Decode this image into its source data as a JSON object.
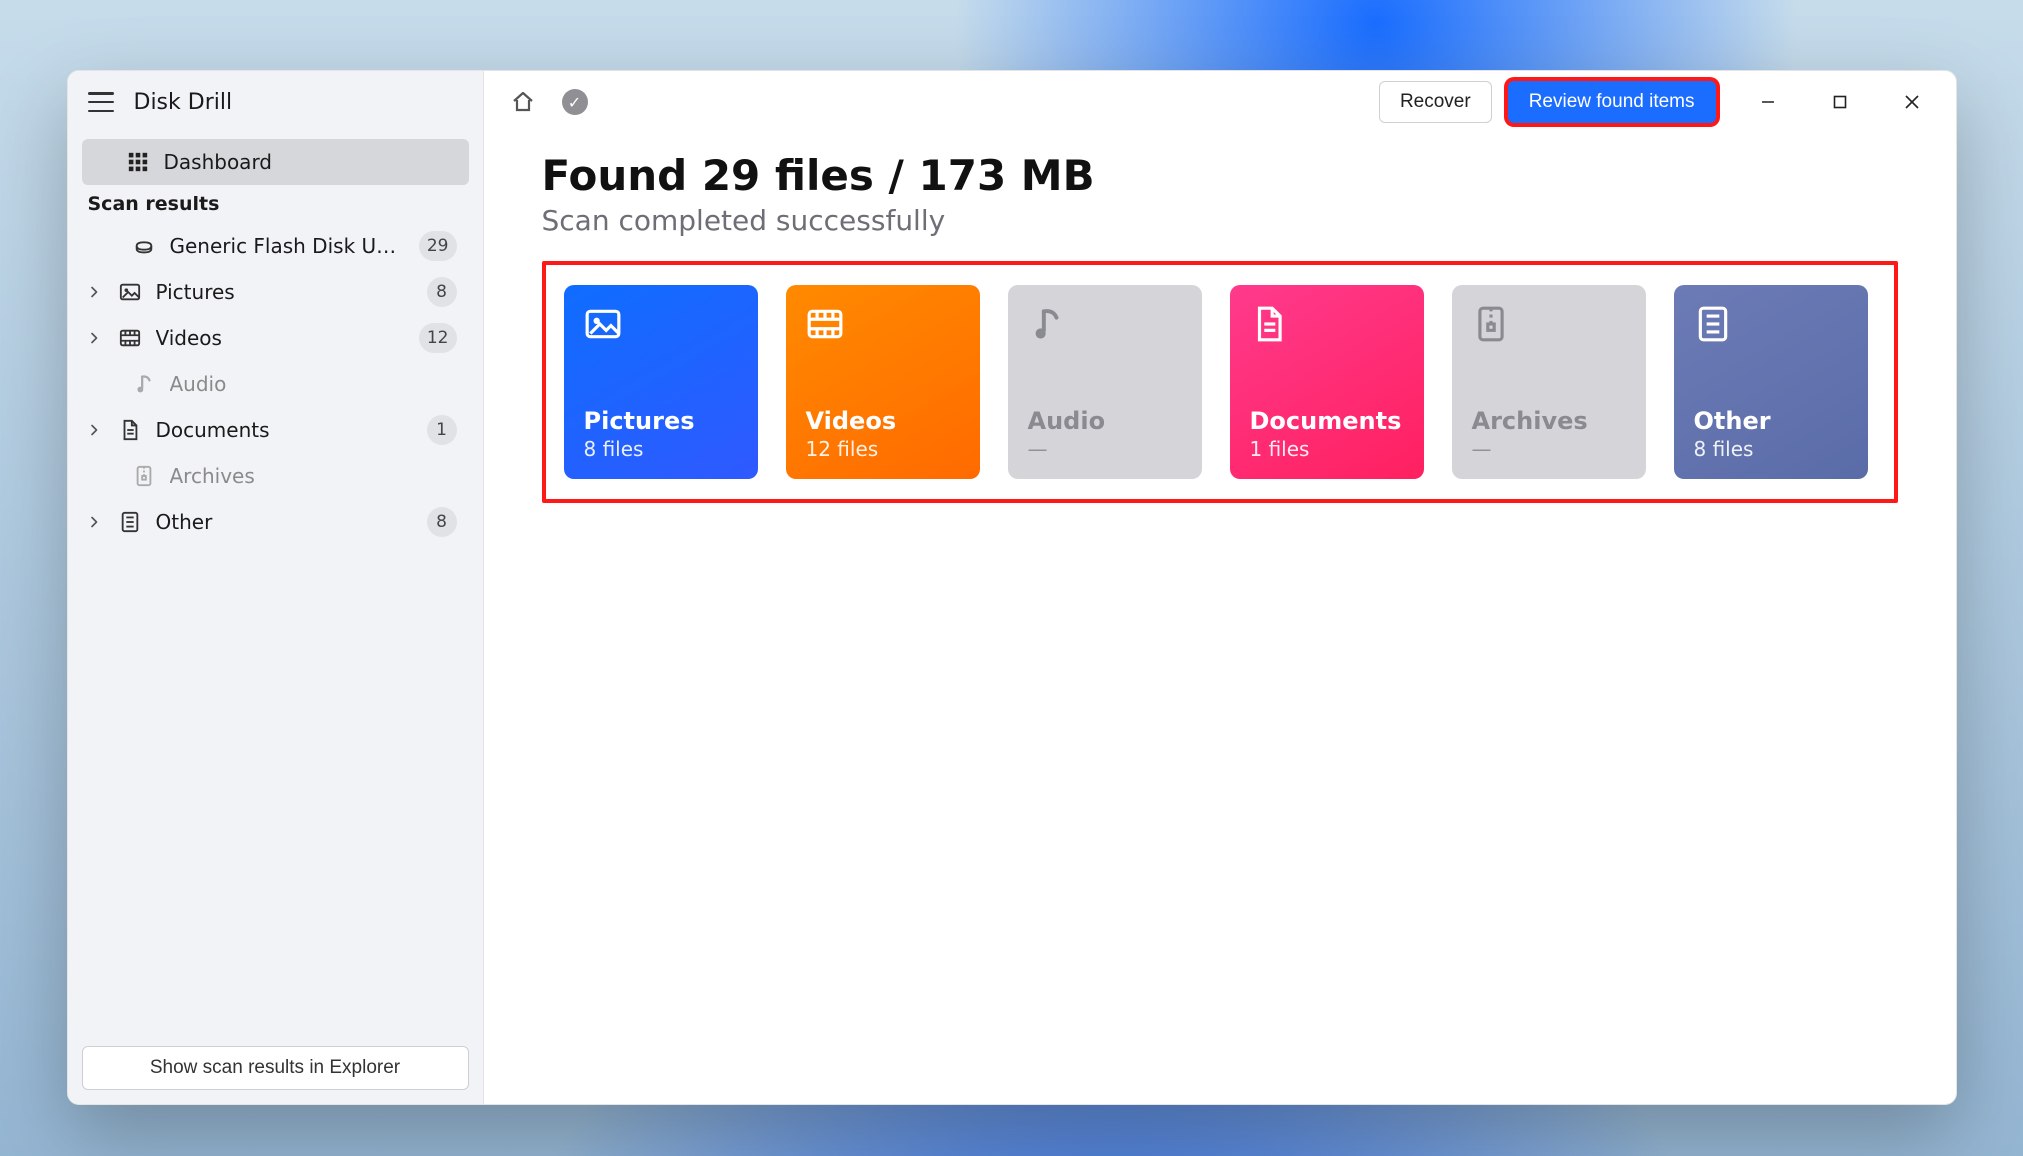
{
  "app": {
    "title": "Disk Drill"
  },
  "sidebar": {
    "dashboard_label": "Dashboard",
    "section_label": "Scan results",
    "footer_button": "Show scan results in Explorer",
    "items": [
      {
        "label": "Generic Flash Disk USB D...",
        "badge": "29",
        "icon": "drive",
        "expandable": false,
        "muted": false,
        "indent": true
      },
      {
        "label": "Pictures",
        "badge": "8",
        "icon": "picture",
        "expandable": true,
        "muted": false,
        "indent": false
      },
      {
        "label": "Videos",
        "badge": "12",
        "icon": "video",
        "expandable": true,
        "muted": false,
        "indent": false
      },
      {
        "label": "Audio",
        "badge": "",
        "icon": "audio",
        "expandable": false,
        "muted": true,
        "indent": true
      },
      {
        "label": "Documents",
        "badge": "1",
        "icon": "document",
        "expandable": true,
        "muted": false,
        "indent": false
      },
      {
        "label": "Archives",
        "badge": "",
        "icon": "archive",
        "expandable": false,
        "muted": true,
        "indent": true
      },
      {
        "label": "Other",
        "badge": "8",
        "icon": "other",
        "expandable": true,
        "muted": false,
        "indent": false
      }
    ]
  },
  "toolbar": {
    "recover_label": "Recover",
    "review_label": "Review found items"
  },
  "main": {
    "headline": "Found 29 files / 173 MB",
    "subhead": "Scan completed successfully"
  },
  "cards": [
    {
      "title": "Pictures",
      "sub": "8 files",
      "style": "pictures",
      "icon": "picture",
      "empty": false
    },
    {
      "title": "Videos",
      "sub": "12 files",
      "style": "videos",
      "icon": "video",
      "empty": false
    },
    {
      "title": "Audio",
      "sub": "—",
      "style": "empty",
      "icon": "audio",
      "empty": true
    },
    {
      "title": "Documents",
      "sub": "1 files",
      "style": "documents",
      "icon": "document",
      "empty": false
    },
    {
      "title": "Archives",
      "sub": "—",
      "style": "empty",
      "icon": "archive",
      "empty": true
    },
    {
      "title": "Other",
      "sub": "8 files",
      "style": "other",
      "icon": "other",
      "empty": false
    }
  ]
}
